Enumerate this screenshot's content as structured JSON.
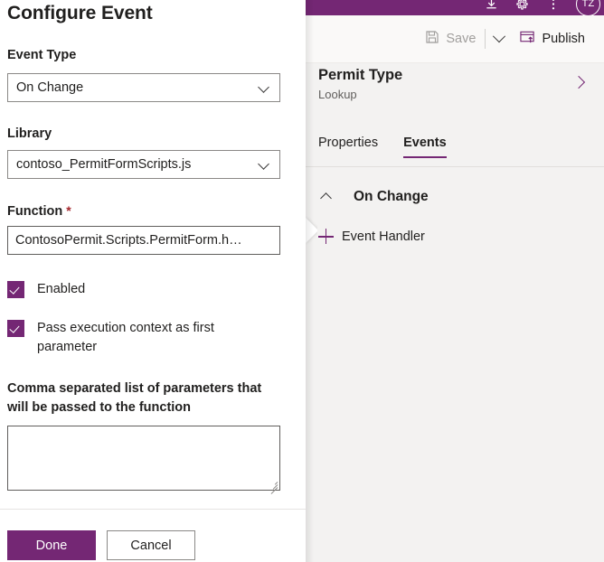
{
  "dialog": {
    "title": "Configure Event",
    "event_type": {
      "label": "Event Type",
      "value": "On Change",
      "chevron_icon": "chevron-down-icon"
    },
    "library": {
      "label": "Library",
      "value": "contoso_PermitFormScripts.js",
      "chevron_icon": "chevron-down-icon"
    },
    "function": {
      "label": "Function",
      "required_marker": "*",
      "value": "ContosoPermit.Scripts.PermitForm.h…"
    },
    "enabled_checkbox": {
      "label": "Enabled",
      "checked": true
    },
    "pass_context_checkbox": {
      "label": "Pass execution context as first parameter",
      "checked": true
    },
    "parameters": {
      "label": "Comma separated list of parameters that will be passed to the function",
      "value": "",
      "placeholder": ""
    },
    "footer": {
      "done_label": "Done",
      "cancel_label": "Cancel"
    }
  },
  "right_panel": {
    "topbar": {
      "icons": [
        "download-icon",
        "gear-icon",
        "more-vertical-icon"
      ],
      "avatar_initials": "TZ"
    },
    "commandbar": {
      "save_label": "Save",
      "save_icon": "save-floppy-icon",
      "save_dropdown_icon": "chevron-down-icon",
      "publish_label": "Publish",
      "publish_icon": "publish-icon"
    },
    "selection": {
      "name": "Permit Type",
      "type": "Lookup",
      "expand_icon": "chevron-right-icon"
    },
    "tabs": [
      {
        "label": "Properties",
        "active": false
      },
      {
        "label": "Events",
        "active": true
      }
    ],
    "section": {
      "collapse_icon": "chevron-up-icon",
      "title": "On Change"
    },
    "add_handler": {
      "icon": "plus-icon",
      "label": "Event Handler"
    }
  },
  "colors": {
    "brand_purple": "#742774",
    "panel_bg": "#f3f2f1",
    "command_bg": "#faf9f8",
    "disabled_text": "#a19f9d",
    "required_red": "#a4262c"
  }
}
